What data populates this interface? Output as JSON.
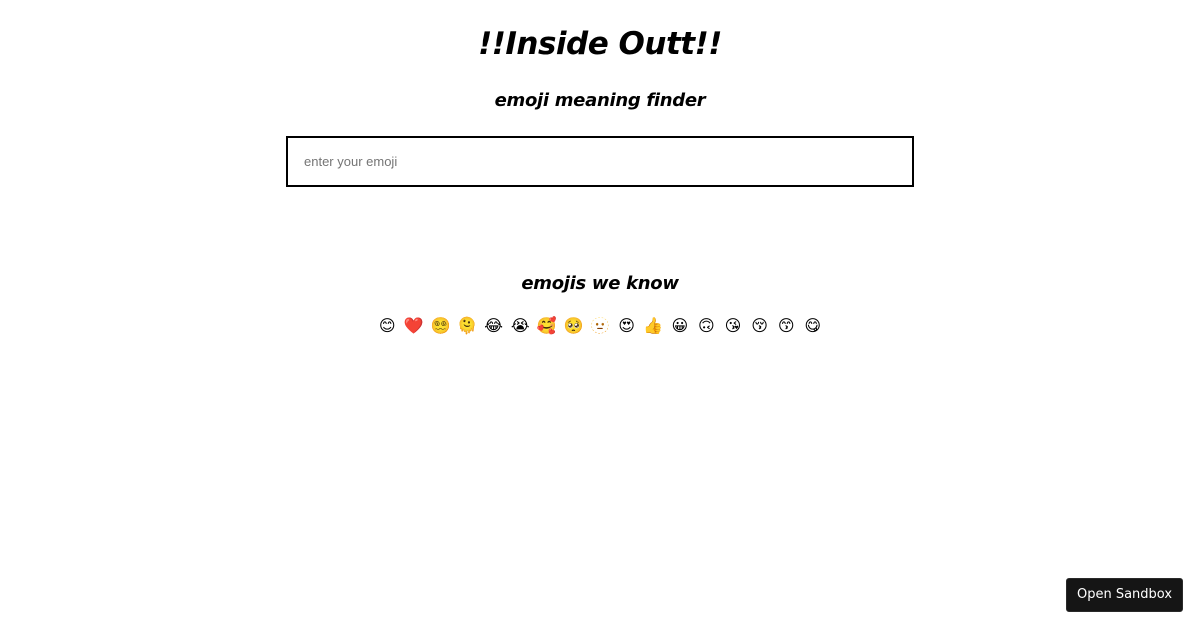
{
  "header": {
    "title": "!!Inside Outt!!",
    "subtitle": "emoji meaning finder"
  },
  "search": {
    "placeholder": "enter your emoji",
    "value": ""
  },
  "result": {
    "meaning": ""
  },
  "known": {
    "heading": "emojis we know",
    "emojis": [
      "😊",
      "❤️",
      "😵‍💫",
      "🫠",
      "😂",
      "😭",
      "🥰",
      "🥺",
      "🫥",
      "😍",
      "👍",
      "😀",
      "🙃",
      "😘",
      "😚",
      "😙",
      "😋"
    ]
  },
  "sandbox": {
    "label": "Open Sandbox"
  }
}
